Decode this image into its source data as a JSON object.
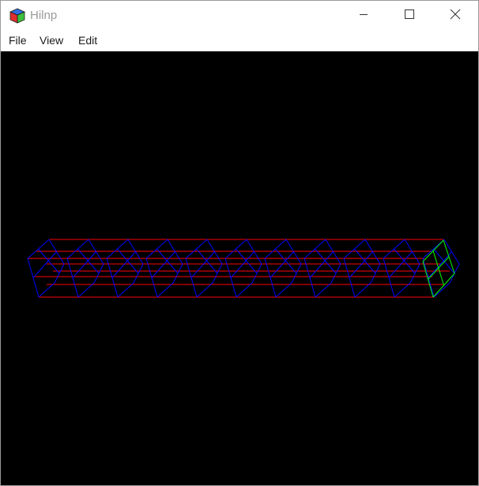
{
  "window": {
    "title": "Hilnp",
    "icon": "colored-cube-icon",
    "controls": [
      "minimize-icon",
      "maximize-icon",
      "close-icon"
    ]
  },
  "menubar": {
    "items": [
      {
        "label": "File"
      },
      {
        "label": "View"
      },
      {
        "label": "Edit"
      }
    ]
  },
  "viewport": {
    "background": "#000000",
    "content": "wireframe-beam",
    "colors": {
      "longitudinal_lines": "#ff0000",
      "cross_sections": "#0000ff",
      "end_face": "#00ff00"
    }
  }
}
